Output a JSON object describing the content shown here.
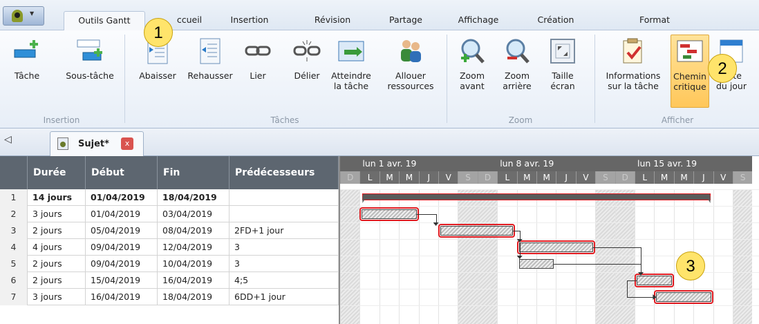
{
  "tabs": [
    {
      "label": "Outils Gantt",
      "active": true
    },
    {
      "label": "ccueil"
    },
    {
      "label": "Insertion"
    },
    {
      "label": "Révision"
    },
    {
      "label": "Partage"
    },
    {
      "label": "Affichage"
    },
    {
      "label": "Création"
    },
    {
      "label": "Format"
    }
  ],
  "ribbon": {
    "groups": {
      "insertion": "Insertion",
      "taches": "Tâches",
      "zoom": "Zoom",
      "afficher": "Afficher"
    },
    "buttons": {
      "tache": "Tâche",
      "sous_tache": "Sous-tâche",
      "abaisser": "Abaisser",
      "rehausser": "Rehausser",
      "lier": "Lier",
      "delier": "Délier",
      "atteindre1": "Atteindre",
      "atteindre2": "la tâche",
      "allouer1": "Allouer",
      "allouer2": "ressources",
      "zoom_avant1": "Zoom",
      "zoom_avant2": "avant",
      "zoom_arriere1": "Zoom",
      "zoom_arriere2": "arrière",
      "taille1": "Taille",
      "taille2": "écran",
      "infos1": "Informations",
      "infos2": "sur la tâche",
      "chemin1": "Chemin",
      "chemin2": "critique",
      "date1": "Date",
      "date2": "du jour"
    }
  },
  "badges": [
    "1",
    "2",
    "3"
  ],
  "document_tab": {
    "label": "Sujet*",
    "close": "x"
  },
  "grid": {
    "headers": [
      "Durée",
      "Début",
      "Fin",
      "Prédécesseurs"
    ],
    "rows": [
      {
        "n": "1",
        "duree": "14 jours",
        "debut": "01/04/2019",
        "fin": "18/04/2019",
        "pred": "",
        "bold": true
      },
      {
        "n": "2",
        "duree": "3 jours",
        "debut": "01/04/2019",
        "fin": "03/04/2019",
        "pred": ""
      },
      {
        "n": "3",
        "duree": "2 jours",
        "debut": "05/04/2019",
        "fin": "08/04/2019",
        "pred": "2FD+1 jour"
      },
      {
        "n": "4",
        "duree": "4 jours",
        "debut": "09/04/2019",
        "fin": "12/04/2019",
        "pred": "3"
      },
      {
        "n": "5",
        "duree": "2 jours",
        "debut": "09/04/2019",
        "fin": "10/04/2019",
        "pred": "3"
      },
      {
        "n": "6",
        "duree": "2 jours",
        "debut": "15/04/2019",
        "fin": "16/04/2019",
        "pred": "4;5"
      },
      {
        "n": "7",
        "duree": "3 jours",
        "debut": "16/04/2019",
        "fin": "18/04/2019",
        "pred": "6DD+1 jour"
      }
    ]
  },
  "gantt": {
    "weeks": [
      "lun 1 avr. 19",
      "lun 8 avr. 19",
      "lun 15 avr. 19"
    ],
    "days": [
      "D",
      "L",
      "M",
      "M",
      "J",
      "V",
      "S",
      "D",
      "L",
      "M",
      "M",
      "J",
      "V",
      "S",
      "D",
      "L",
      "M",
      "M",
      "J",
      "V",
      "S"
    ],
    "colors": {
      "critical": "#e0191f",
      "bar": "#bdbdbd"
    }
  }
}
